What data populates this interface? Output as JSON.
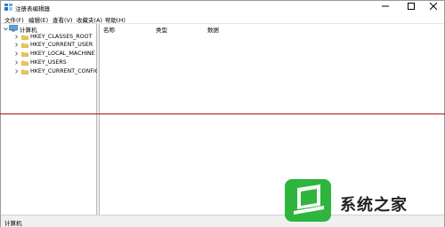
{
  "window": {
    "title": "注册表编辑器",
    "status": "计算机"
  },
  "menu": [
    "文件(F)",
    "编辑(E)",
    "查看(V)",
    "收藏夹(A)",
    "帮助(H)"
  ],
  "tree": {
    "root": "计算机",
    "items": [
      "HKEY_CLASSES_ROOT",
      "HKEY_CURRENT_USER",
      "HKEY_LOCAL_MACHINE",
      "HKEY_USERS",
      "HKEY_CURRENT_CONFIG"
    ]
  },
  "list": {
    "columns": [
      "名称",
      "类型",
      "数据"
    ]
  },
  "watermark": {
    "brand": "系统之家"
  },
  "colors": {
    "accent_line": "#b01010",
    "watermark_green": "#2db53d",
    "folder": "#e8c65a"
  },
  "icons": {
    "app": "regedit-icon",
    "computer": "computer-icon",
    "folder": "folder-icon",
    "minimize": "minimize-icon",
    "maximize": "maximize-icon",
    "close": "close-icon"
  }
}
